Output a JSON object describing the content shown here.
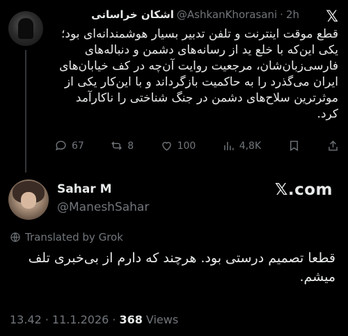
{
  "original_tweet": {
    "display_name": "اشکان خراسانی",
    "handle": "@AshkanKhorasani",
    "separator": "·",
    "time": "2h",
    "text": "قطع موقت اینترنت و تلفن تدبیر بسیار هوشمندانه‌ای بود؛ یکی این‌که با خلع ید از رسانه‌های دشمن و دنباله‌های فارسی‌زبان‌شان، مرجعیت روایت آن‌چه در کف خیابان‌های ایران می‌گذرد را به حاکمیت بازگرداند و با این‌کار یکی از موثرترین سلاح‌های دشمن در جنگ شناختی را ناکارآمد کرد.",
    "actions": {
      "replies": "67",
      "reposts": "8",
      "likes": "100",
      "views": "4,8K"
    },
    "icons": [
      "x-logo-icon",
      "reply-icon",
      "repost-icon",
      "like-icon",
      "views-icon",
      "bookmark-icon",
      "share-icon"
    ]
  },
  "reply_tweet": {
    "display_name": "Sahar M",
    "handle": "@ManeshSahar",
    "watermark": "𝕏.com",
    "translated_label": "Translated by Grok",
    "text": "قطعا تصمیم درستی بود. هرچند که دارم از بی‌خبری تلف میشم.",
    "time": "13.42",
    "separator": "·",
    "date": "11.1.2026",
    "separator2": "·",
    "views_count": "368",
    "views_label": "Views"
  }
}
